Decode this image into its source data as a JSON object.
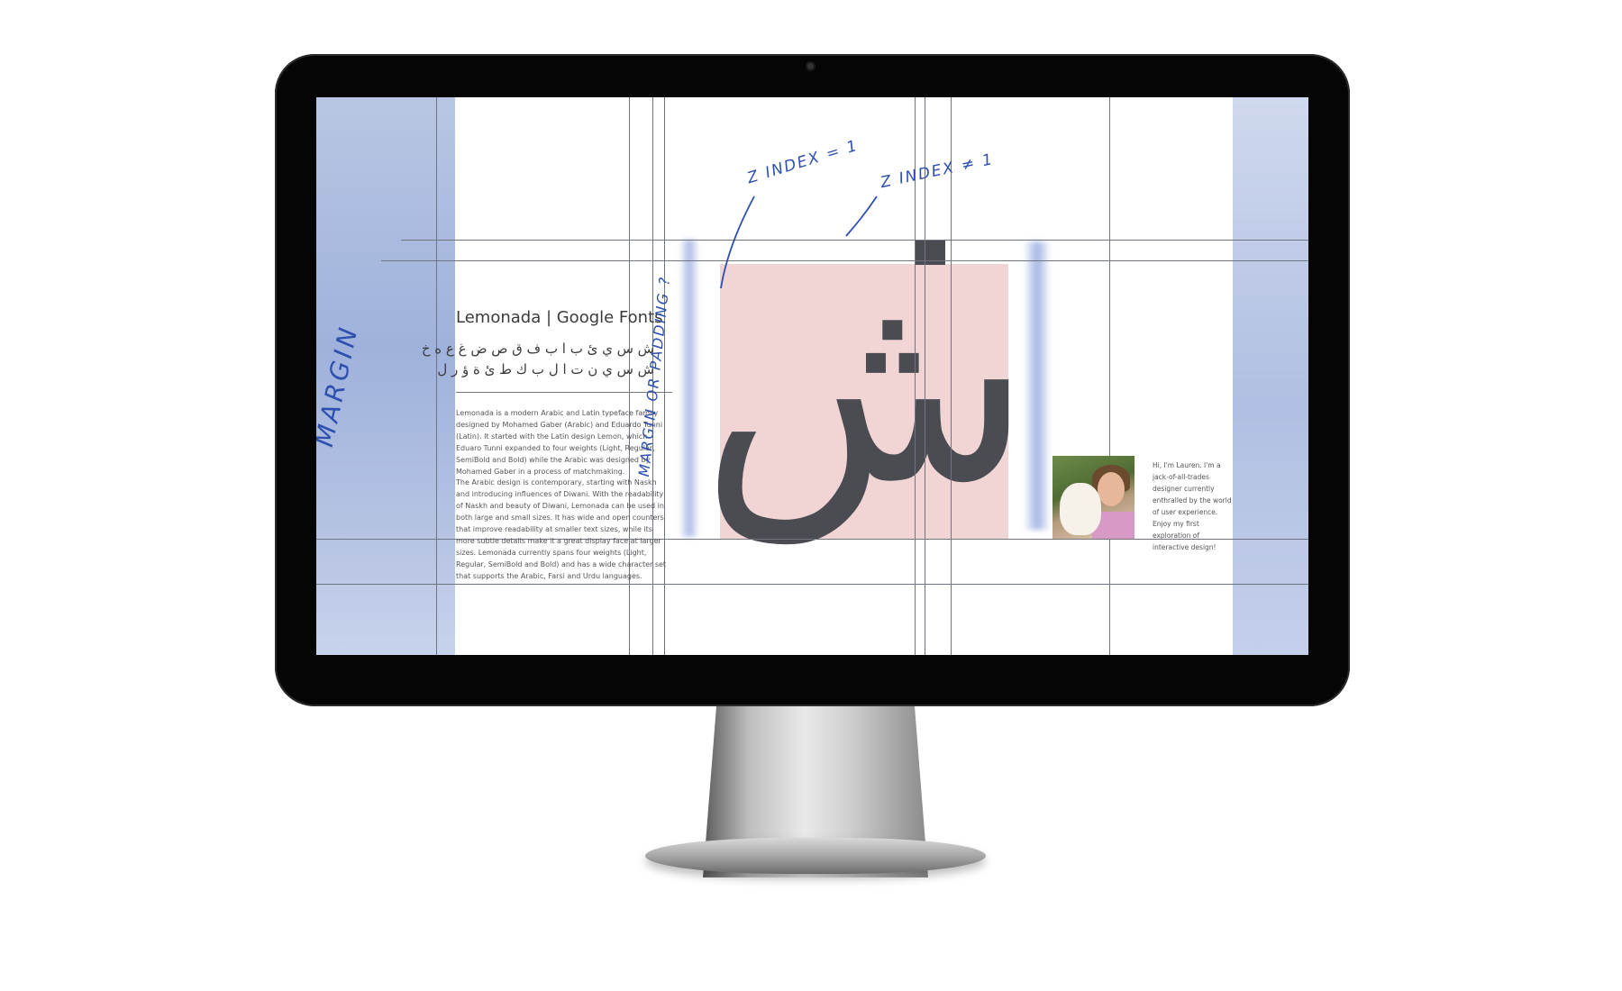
{
  "page": {
    "title": "Lemonada | Google Fonts",
    "arabic_line_1": "ش س ي ئ ب ا ب ف ق ص ض غ ع ه خ",
    "arabic_line_2": "ش س ي ن ت ا ل ب ك ط ئ ة ؤ ر ل",
    "big_glyph": "ش",
    "paragraph_1": "Lemonada is a modern Arabic and Latin typeface family designed by Mohamed Gaber (Arabic) and Eduardo Tunni (Latin). It started with the Latin design Lemon, which Eduaro Tunni expanded to four weights (Light, Regular, SemiBold and Bold) while the Arabic was designed by Mohamed Gaber in a process of matchmaking.",
    "paragraph_2": "The Arabic design is contemporary, starting with Naskh and introducing influences of Diwani. With the readability of Naskh and beauty of Diwani, Lemonada can be used in both large and small sizes. It has wide and open counters that improve readability at smaller text sizes, while its more subtle details make it a great display face at larger sizes. Lemonada currently spans four weights (Light, Regular, SemiBold and Bold) and has a wide character set that supports the Arabic, Farsi and Urdu languages.",
    "bio": "Hi, I'm Lauren. I'm a jack-of-all-trades designer currently enthralled by the world of user experience. Enjoy my first exploration of interactive design!"
  },
  "annotations": {
    "margin": "MARGIN",
    "margin_or_padding": "MARGIN OR PADDING ?",
    "z_index_eq": "Z INDEX = 1",
    "z_index_neq": "Z INDEX ≠ 1"
  },
  "colors": {
    "annotation": "#2d4fae",
    "margin_band": "#a8b8e0",
    "pink_block": "#f0d5d4",
    "glyph": "#4b4c52"
  },
  "icons": {
    "avatar": "profile-photo-with-dog"
  }
}
